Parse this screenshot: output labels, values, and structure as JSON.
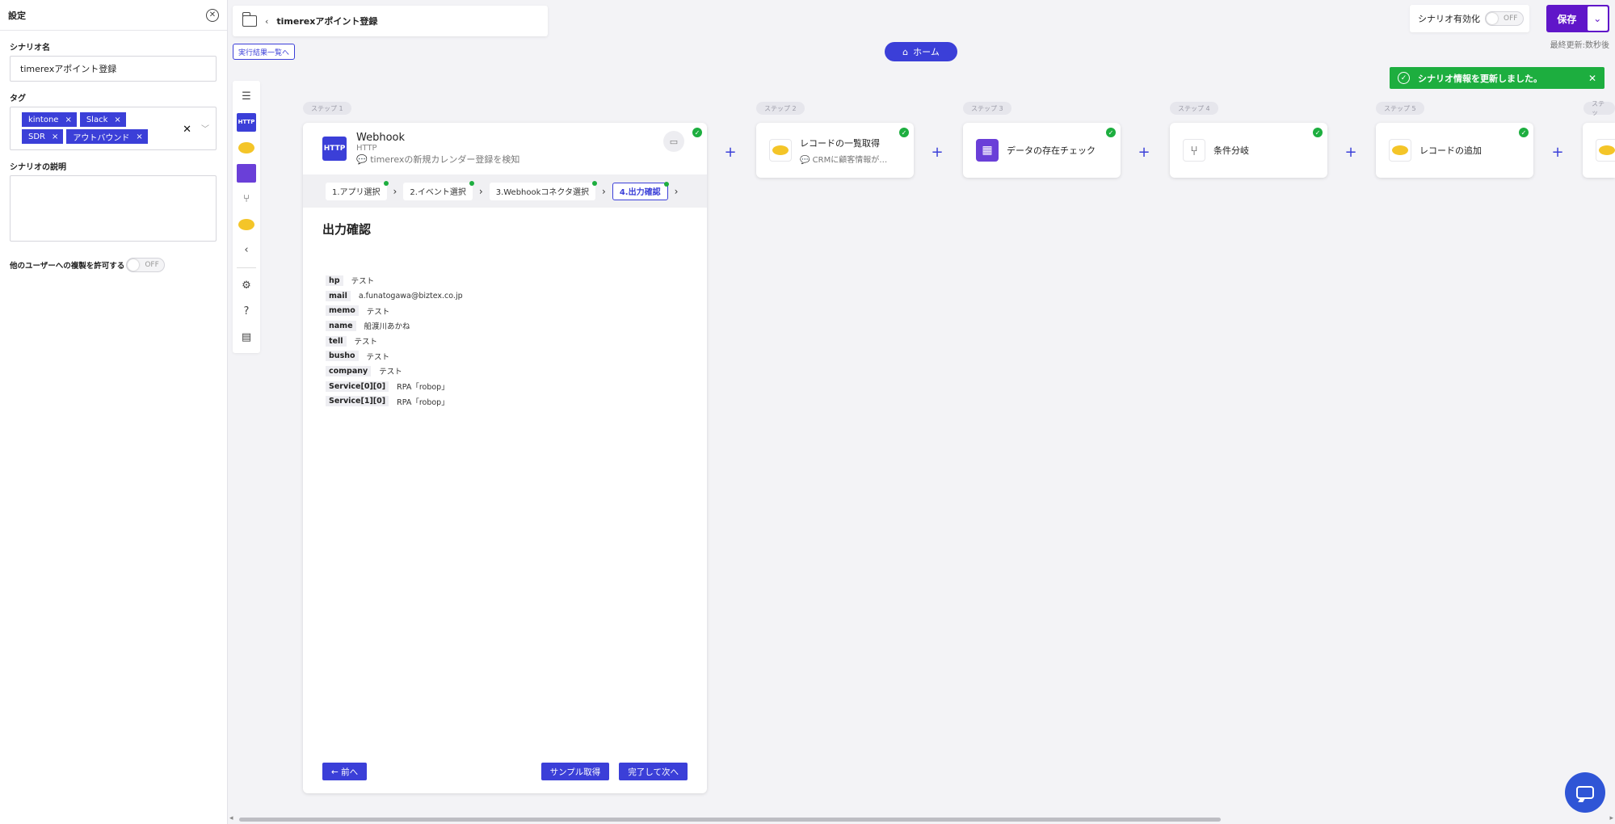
{
  "settings": {
    "title": "設定",
    "scenario_name_label": "シナリオ名",
    "scenario_name_value": "timerexアポイント登録",
    "tags_label": "タグ",
    "tags": [
      "kintone",
      "Slack",
      "SDR",
      "アウトバウンド"
    ],
    "description_label": "シナリオの説明",
    "share_label": "他のユーザーへの複製を許可する",
    "share_toggle": "OFF"
  },
  "header": {
    "breadcrumb": "timerexアポイント登録",
    "results_link": "実行結果一覧へ",
    "home_button": "ホーム",
    "enable_label": "シナリオ有効化",
    "enable_toggle": "OFF",
    "save_button": "保存",
    "last_updated": "最終更新:数秒後",
    "toast": "シナリオ情報を更新しました。"
  },
  "steps": [
    {
      "tag": "ステップ 1",
      "title": "Webhook",
      "app": "HTTP",
      "desc": "timerexの新規カレンダー登録を検知"
    },
    {
      "tag": "ステップ 2",
      "title": "レコードの一覧取得",
      "desc": "CRMに顧客情報が…"
    },
    {
      "tag": "ステップ 3",
      "title": "データの存在チェック"
    },
    {
      "tag": "ステップ 4",
      "title": "条件分岐"
    },
    {
      "tag": "ステップ 5",
      "title": "レコードの追加"
    },
    {
      "tag": "ステッ"
    }
  ],
  "main_card": {
    "tabs": [
      "1.アプリ選択",
      "2.イベント選択",
      "3.Webhookコネクタ選択",
      "4.出力確認"
    ],
    "section_title": "出力確認",
    "outputs": [
      {
        "key": "hp",
        "value": "テスト"
      },
      {
        "key": "mail",
        "value": "a.funatogawa@biztex.co.jp"
      },
      {
        "key": "memo",
        "value": "テスト"
      },
      {
        "key": "name",
        "value": "船渡川あかね"
      },
      {
        "key": "tell",
        "value": "テスト"
      },
      {
        "key": "busho",
        "value": "テスト"
      },
      {
        "key": "company",
        "value": "テスト"
      },
      {
        "key": "Service[0][0]",
        "value": "RPA「robop」"
      },
      {
        "key": "Service[1][0]",
        "value": "RPA「robop」"
      }
    ],
    "prev_button": "← 前へ",
    "sample_button": "サンプル取得",
    "next_button": "完了して次へ"
  },
  "icons": {
    "http_badge": "HTTP",
    "close": "close-icon",
    "chat": "chat-icon"
  },
  "colors": {
    "accent": "#3b3fd8",
    "save": "#6016c9",
    "success": "#1dae3f"
  }
}
